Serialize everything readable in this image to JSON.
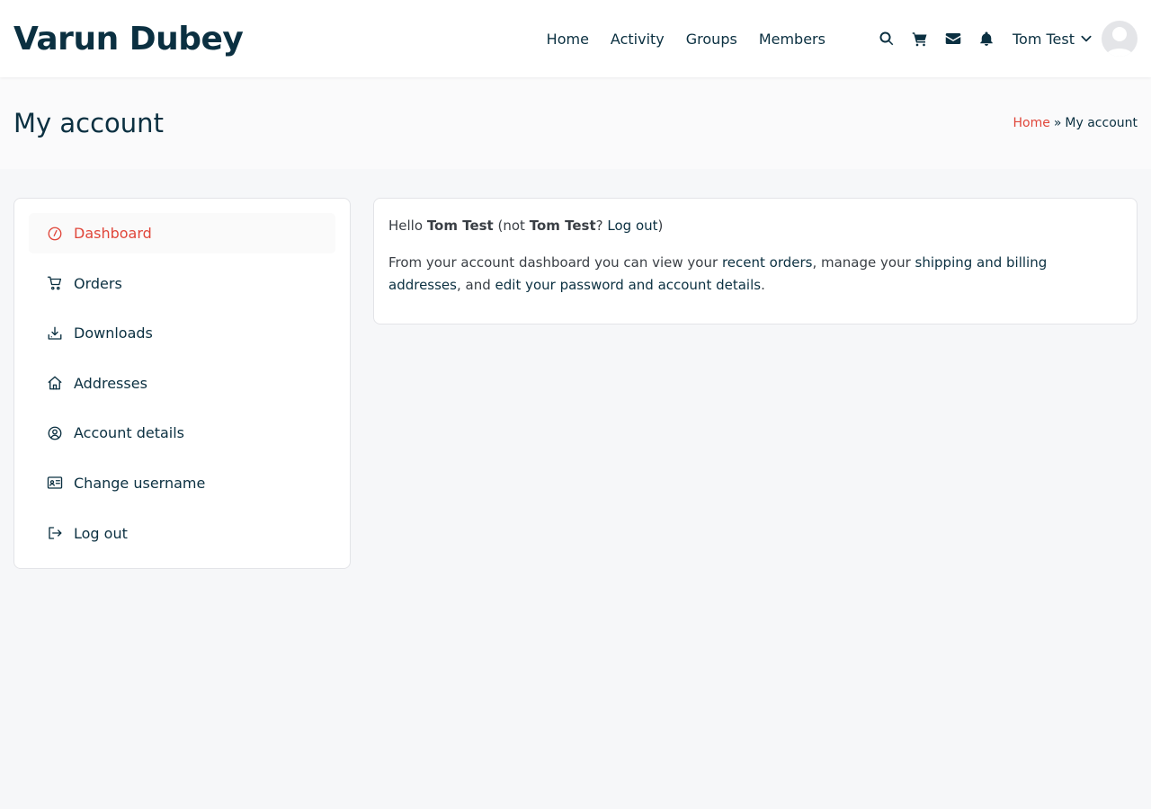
{
  "site": {
    "title": "Varun Dubey"
  },
  "nav": {
    "links": [
      "Home",
      "Activity",
      "Groups",
      "Members"
    ],
    "user_name": "Tom Test"
  },
  "icons": {
    "search": "search-icon",
    "cart": "cart-icon",
    "mail": "envelope-icon",
    "notifications": "bell-icon",
    "chevron": "chevron-down-icon",
    "avatar": "user-avatar"
  },
  "page": {
    "title": "My account",
    "breadcrumb": {
      "home": "Home",
      "separator": "»",
      "current": "My account"
    }
  },
  "sidebar": {
    "items": [
      {
        "label": "Dashboard",
        "icon": "dashboard-gauge-icon",
        "active": true
      },
      {
        "label": "Orders",
        "icon": "cart-icon",
        "active": false
      },
      {
        "label": "Downloads",
        "icon": "download-icon",
        "active": false
      },
      {
        "label": "Addresses",
        "icon": "home-icon",
        "active": false
      },
      {
        "label": "Account details",
        "icon": "user-circle-icon",
        "active": false
      },
      {
        "label": "Change username",
        "icon": "id-card-icon",
        "active": false
      },
      {
        "label": "Log out",
        "icon": "logout-icon",
        "active": false
      }
    ]
  },
  "content": {
    "hello": "Hello",
    "user_name": "Tom Test",
    "not_open": "(not",
    "not_user": "Tom Test",
    "question": "?",
    "logout_link": "Log out",
    "close_paren": ")",
    "intro": "From your account dashboard you can view your",
    "recent_orders_link": "recent orders",
    "manage": ", manage your",
    "addresses_link": "shipping and billing addresses",
    "and": ", and",
    "account_link": "edit your password and account details",
    "period": "."
  },
  "colors": {
    "primary_text": "#0b3041",
    "accent": "#e0463a",
    "page_bg": "#f6f7f9",
    "card_bg": "#ffffff",
    "border": "#e3e4e8"
  }
}
